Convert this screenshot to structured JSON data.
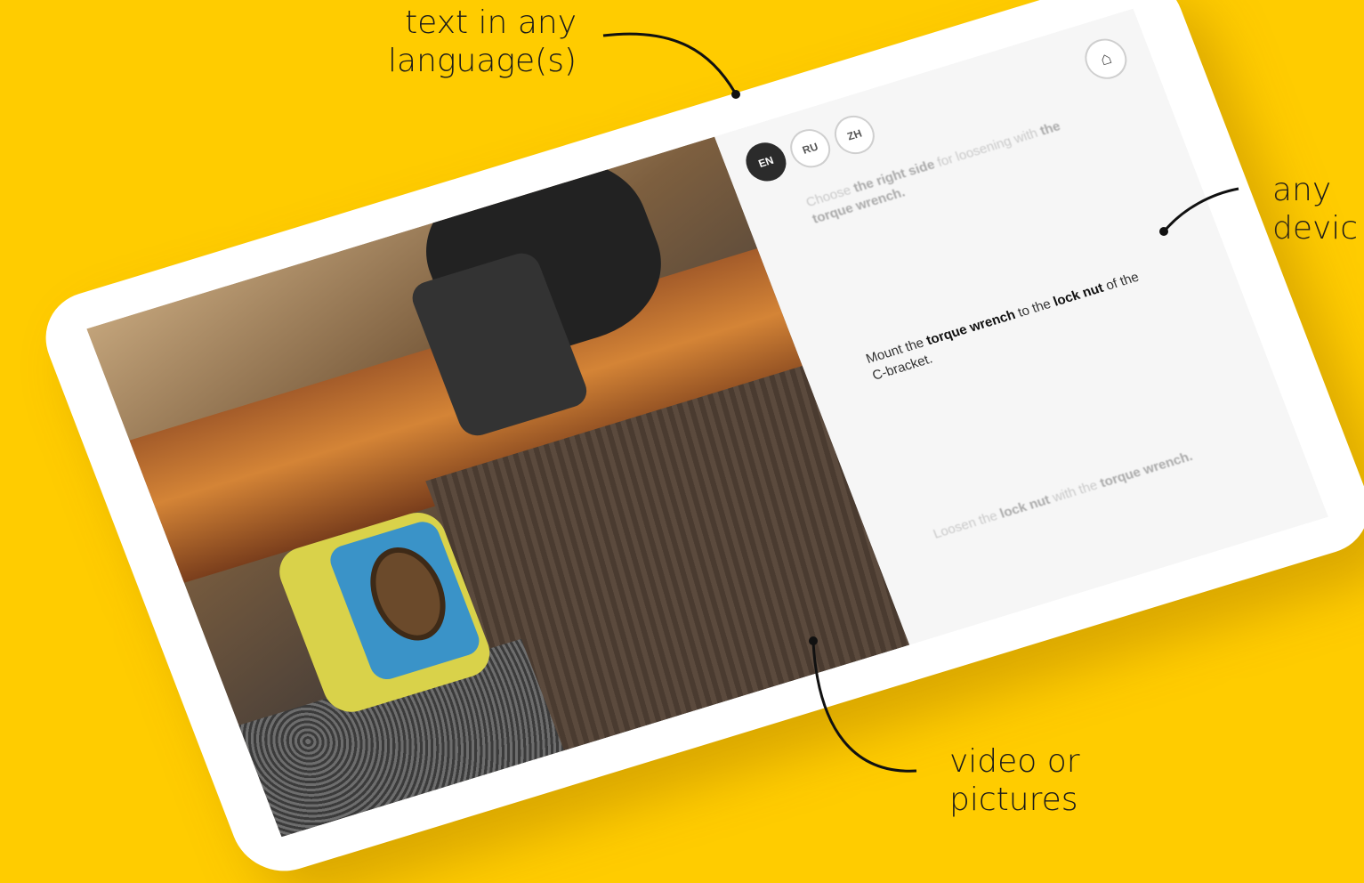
{
  "callouts": {
    "language": [
      "text in any",
      "language(s)"
    ],
    "device": [
      "any",
      "devic"
    ],
    "video": [
      "video or",
      "pictures"
    ]
  },
  "app": {
    "languages": [
      {
        "code": "EN",
        "active": true
      },
      {
        "code": "RU",
        "active": false
      },
      {
        "code": "ZH",
        "active": false
      }
    ],
    "home_icon": "home-icon",
    "steps": {
      "previous": {
        "pre": "Choose ",
        "b1": "the right side",
        "mid": " for loosening with ",
        "b2": "the torque wrench."
      },
      "current": {
        "pre": "Mount the ",
        "b1": "torque wrench",
        "mid": " to the ",
        "b2": "lock nut",
        "post": " of the C-bracket."
      },
      "next": {
        "pre": "Loosen the ",
        "b1": "lock nut",
        "mid": " with the ",
        "b2": "torque wrench."
      }
    }
  },
  "colors": {
    "background": "#FFCC00",
    "tablet": "#FFFFFF",
    "active_lang": "#2B2B2B"
  }
}
